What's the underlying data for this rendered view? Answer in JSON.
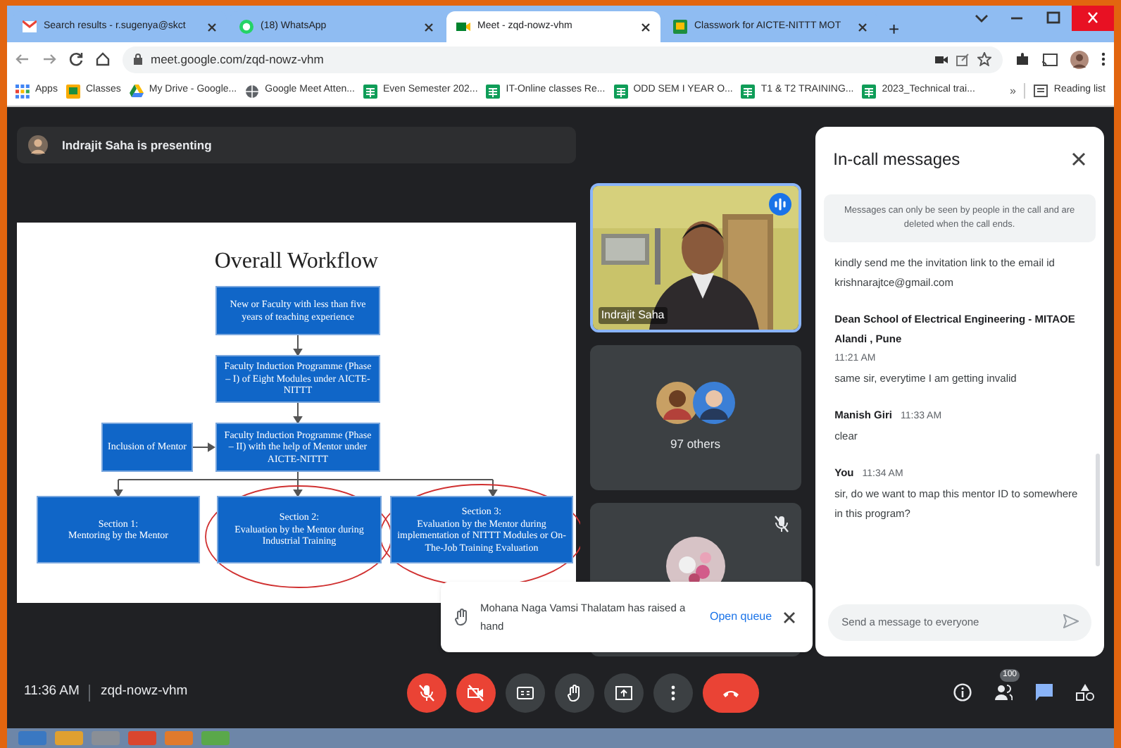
{
  "browser": {
    "tabs": [
      {
        "kind": "gmail",
        "label": "Search results - r.sugenya@skct",
        "selected": false
      },
      {
        "kind": "whatsapp",
        "label": "(18) WhatsApp",
        "selected": false
      },
      {
        "kind": "meet",
        "label": "Meet - zqd-nowz-vhm",
        "selected": true
      },
      {
        "kind": "classroom",
        "label": "Classwork for AICTE-NITTT MOT",
        "selected": false
      }
    ],
    "new_tab": "+",
    "url": "meet.google.com/zqd-nowz-vhm",
    "bookmarks": [
      {
        "kind": "apps",
        "label": "Apps"
      },
      {
        "kind": "classroom",
        "label": "Classes"
      },
      {
        "kind": "drive",
        "label": "My Drive - Google..."
      },
      {
        "kind": "globe",
        "label": "Google Meet Atten..."
      },
      {
        "kind": "sheets",
        "label": "Even Semester 202..."
      },
      {
        "kind": "sheets",
        "label": "IT-Online classes Re..."
      },
      {
        "kind": "sheets",
        "label": "ODD SEM I YEAR O..."
      },
      {
        "kind": "sheets",
        "label": "T1 & T2 TRAINING..."
      },
      {
        "kind": "sheets",
        "label": "2023_Technical trai..."
      }
    ],
    "more_bookmarks": "»",
    "reading_list": "Reading list"
  },
  "meet": {
    "presenter_banner": "Indrajit Saha is presenting",
    "slide": {
      "title": "Overall Workflow",
      "boxes": [
        {
          "text": "New or Faculty with less than five years of teaching experience",
          "circled": false
        },
        {
          "text": "Faculty Induction Programme (Phase – I) of Eight Modules under AICTE-NITTT",
          "circled": false
        },
        {
          "text": "Inclusion of Mentor",
          "circled": false
        },
        {
          "text": "Faculty Induction Programme (Phase – II) with the help of Mentor under AICTE-NITTT",
          "circled": false
        },
        {
          "heading": "Section 1:",
          "text": "Mentoring by the Mentor",
          "circled": false
        },
        {
          "heading": "Section 2:",
          "text": "Evaluation by the Mentor during Industrial Training",
          "circled": true
        },
        {
          "heading": "Section 3:",
          "text": "Evaluation by the Mentor during implementation of NITTT Modules or On-The-Job Training Evaluation",
          "circled": true
        }
      ]
    },
    "tiles": [
      {
        "kind": "video",
        "name": "Indrajit Saha",
        "speaking": true
      },
      {
        "kind": "group",
        "label": "97 others"
      },
      {
        "kind": "avatar",
        "muted": true
      }
    ],
    "chat": {
      "title": "In-call messages",
      "notice": "Messages can only be seen by people in the call and are deleted when the call ends.",
      "messages": [
        {
          "text": "kindly send me the invitation link to the email id krishnarajtce@gmail.com"
        },
        {
          "sender": "Dean School of Electrical Engineering - MITAOE Alandi , Pune",
          "time": "11:21 AM",
          "text": "same sir, everytime I am getting invalid"
        },
        {
          "sender": "Manish Giri",
          "time": "11:33 AM",
          "text": "clear"
        },
        {
          "sender": "You",
          "time": "11:34 AM",
          "text": "sir, do we want to map this mentor ID to somewhere in this program?"
        }
      ],
      "placeholder": "Send a message to everyone"
    },
    "toast": {
      "text": "Mohana Naga Vamsi Thalatam has raised a hand",
      "action": "Open queue"
    },
    "bottom_bar": {
      "time": "11:36 AM",
      "meeting_code": "zqd-nowz-vhm",
      "controls": [
        {
          "kind": "mic",
          "on": false
        },
        {
          "kind": "camera",
          "on": false
        },
        {
          "kind": "captions"
        },
        {
          "kind": "hand"
        },
        {
          "kind": "present"
        },
        {
          "kind": "more"
        },
        {
          "kind": "end"
        }
      ],
      "side_buttons": [
        {
          "kind": "info",
          "selected": false
        },
        {
          "kind": "people",
          "badge": "100",
          "selected": false
        },
        {
          "kind": "chat",
          "selected": true
        },
        {
          "kind": "activities",
          "selected": false
        }
      ]
    }
  }
}
